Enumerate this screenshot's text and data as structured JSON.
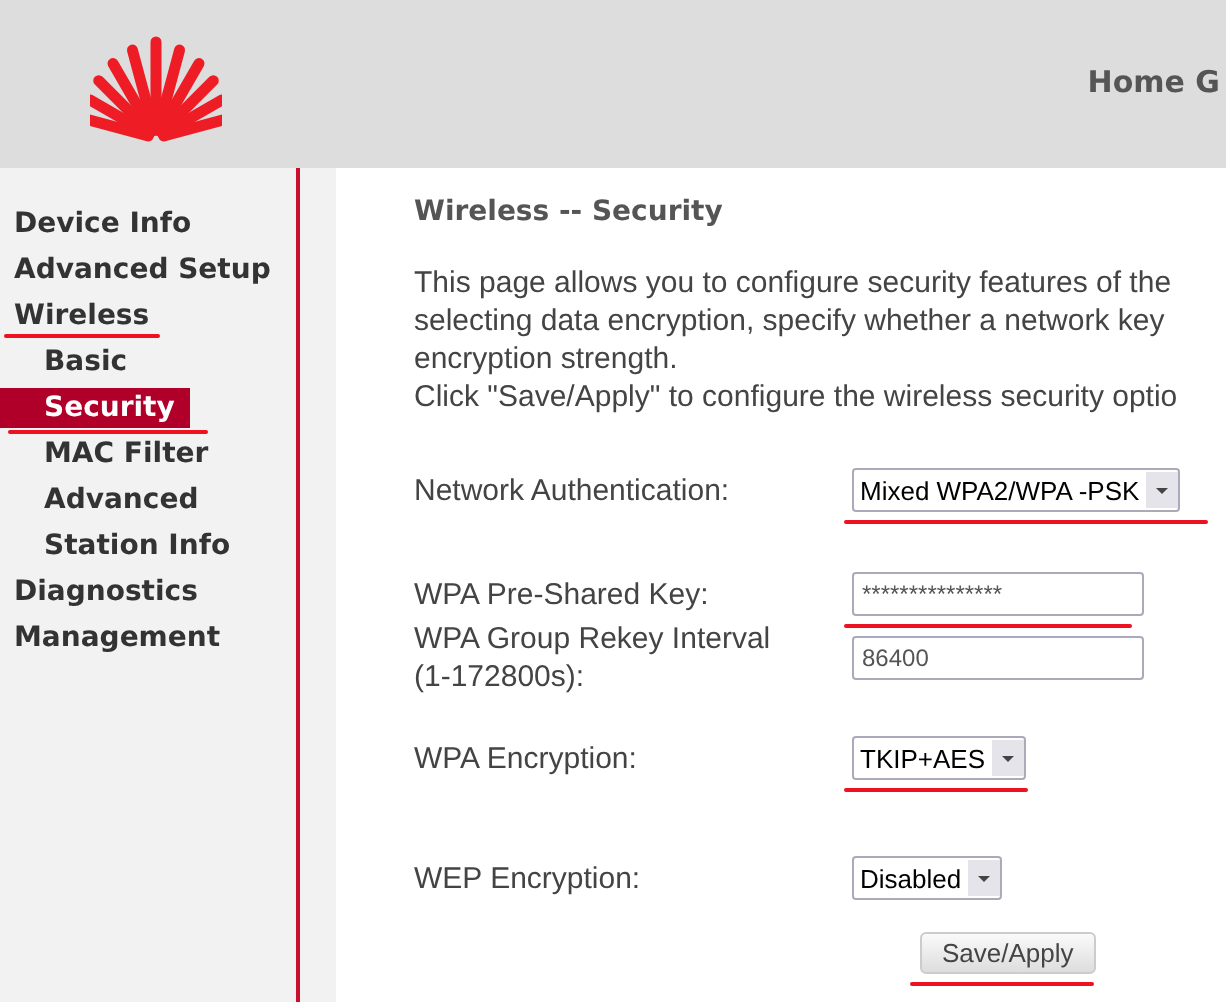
{
  "header": {
    "title": "Home G"
  },
  "sidebar": {
    "items": [
      {
        "label": "Device Info",
        "selected": false,
        "underlined": false
      },
      {
        "label": "Advanced Setup",
        "selected": false,
        "underlined": false
      },
      {
        "label": "Wireless",
        "selected": false,
        "underlined": true,
        "children": [
          {
            "label": "Basic",
            "selected": false,
            "underlined": false
          },
          {
            "label": "Security",
            "selected": true,
            "underlined": true
          },
          {
            "label": "MAC Filter",
            "selected": false,
            "underlined": false
          },
          {
            "label": "Advanced",
            "selected": false,
            "underlined": false
          },
          {
            "label": "Station Info",
            "selected": false,
            "underlined": false
          }
        ]
      },
      {
        "label": "Diagnostics",
        "selected": false,
        "underlined": false
      },
      {
        "label": "Management",
        "selected": false,
        "underlined": false
      }
    ]
  },
  "page": {
    "title": "Wireless -- Security",
    "description": [
      "This page allows you to configure security features of the",
      "selecting data encryption, specify whether a network key",
      "encryption strength.",
      "Click \"Save/Apply\" to configure the wireless security optio"
    ],
    "fields": [
      {
        "kind": "select",
        "label": "Network Authentication:",
        "value": "Mixed WPA2/WPA -PSK",
        "underlined": true
      },
      {
        "kind": "password",
        "label": "WPA Pre-Shared Key:",
        "value": "***************",
        "underlined": true
      },
      {
        "kind": "text",
        "label": "WPA Group Rekey Interval (1-172800s):",
        "value": "86400",
        "underlined": false
      },
      {
        "kind": "select",
        "label": "WPA Encryption:",
        "value": "TKIP+AES",
        "underlined": true
      },
      {
        "kind": "select",
        "label": "WEP Encryption:",
        "value": "Disabled",
        "underlined": false
      }
    ],
    "save_button": {
      "label": "Save/Apply",
      "underlined": true
    }
  }
}
